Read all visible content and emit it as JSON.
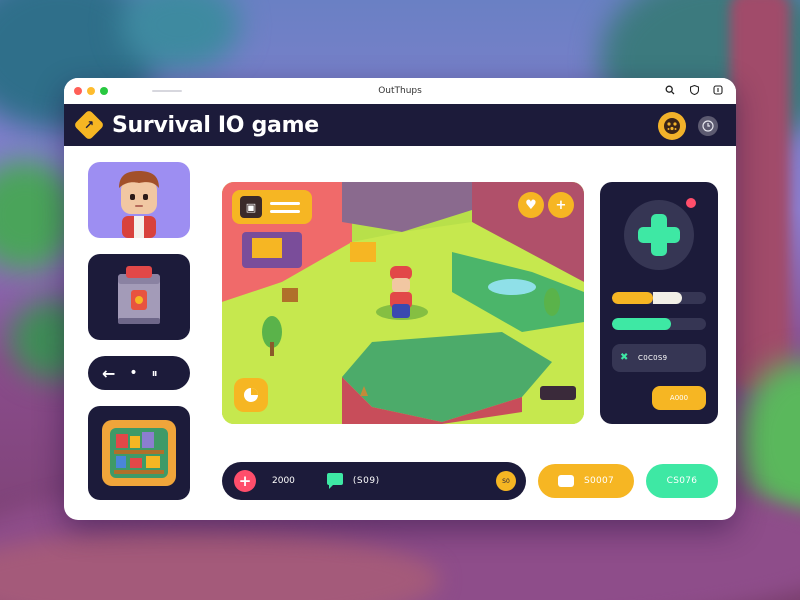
{
  "window": {
    "title": "OutThups"
  },
  "header": {
    "title": "Survival IO game"
  },
  "controls_tile": {
    "left_arrow": "←",
    "dot": "•",
    "pause": "⏸"
  },
  "viewport": {
    "heart_icon": "♥",
    "plus_label": "+"
  },
  "panel": {
    "yellow_bar_level": 0.44,
    "green_bar_level": 0.63,
    "stat_value": "C0C0S9",
    "action_label": "A000"
  },
  "bottom_bar": {
    "plus_label": "+",
    "count": "2000",
    "chat_value": "(S09)",
    "coin_label": "S0"
  },
  "buttons": {
    "yellow_pill": "S0007",
    "green_pill": "CS076"
  },
  "colors": {
    "navy": "#1c1b3a",
    "accent_yellow": "#f6b623",
    "accent_green": "#3ee8a4",
    "accent_red": "#ff4e6b",
    "avatar_tile": "#9d8ef2"
  }
}
